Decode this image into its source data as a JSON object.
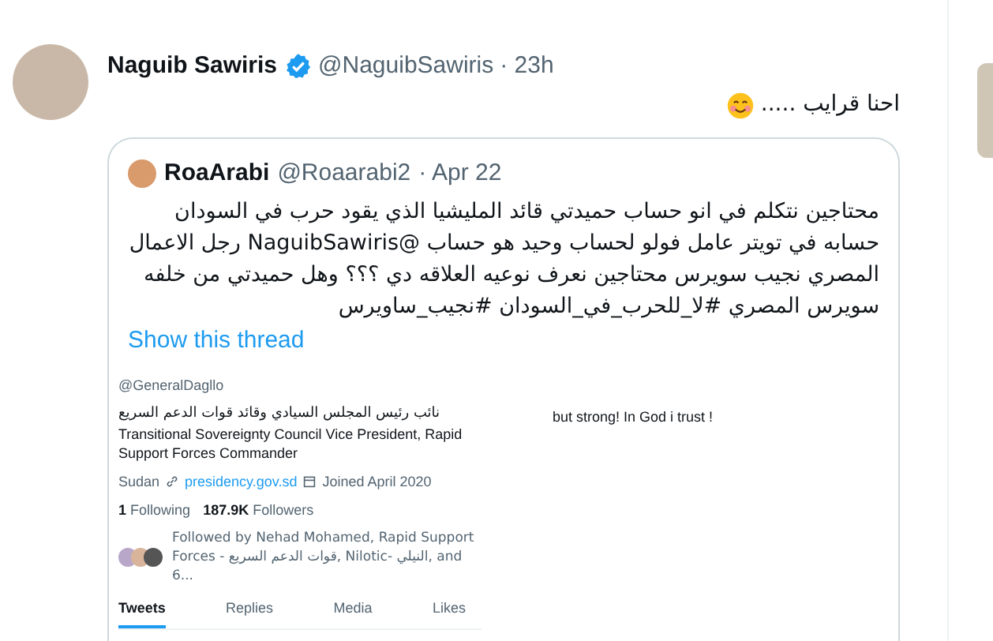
{
  "tweet": {
    "name": "Naguib Sawiris",
    "verified": true,
    "handle": "@NaguibSawiris",
    "time": "· 23h",
    "text": "احنا قرايب .....",
    "quoted": {
      "name": "RoaArabi",
      "handle": "@Roaarabi2",
      "time": "· Apr 22",
      "text": "محتاجين نتكلم في انو حساب حميدتي قائد المليشيا الذي يقود حرب في السودان حسابه في تويتر عامل فولو لحساب وحيد هو حساب @NaguibSawiris  رجل الاعمال المصري نجيب سويرس محتاجين نعرف نوعيه العلاقه دي ؟؟؟ وهل حميدتي من خلفه سويرس المصري #لا_للحرب_في_السودان  #نجيب_ساويرس",
      "thread_link": "Show this thread",
      "image": {
        "handle": "@GeneralDagllo",
        "bio_ar": "نائب رئيس المجلس السيادي وقائد قوات الدعم السريع",
        "bio_en": "Transitional Sovereignty Council Vice President, Rapid Support Forces Commander",
        "location": "Sudan",
        "website": "presidency.gov.sd",
        "joined": "Joined April 2020",
        "following_count": "1",
        "following_label": "Following",
        "followers_count": "187.9K",
        "followers_label": "Followers",
        "followed_by": "Followed by Nehad Mohamed, Rapid Support Forces - قوات الدعم السريع, Nilotic- النيلي, and 6...",
        "tabs": [
          {
            "label": "Tweets",
            "selected": true
          },
          {
            "label": "Replies",
            "selected": false
          },
          {
            "label": "Media",
            "selected": false
          },
          {
            "label": "Likes",
            "selected": false
          }
        ],
        "side_text": "but strong! In God i trust !"
      }
    }
  }
}
